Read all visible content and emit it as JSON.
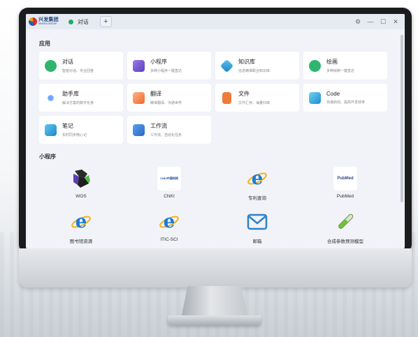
{
  "window": {
    "logo_cn": "兴发集团",
    "logo_en": "XINGFA GROUP",
    "tab_label": "对话",
    "new_tab_symbol": "+",
    "controls": {
      "settings": "⚙",
      "minimize": "—",
      "maximize": "☐",
      "close": "✕"
    }
  },
  "apps": {
    "section_title": "应用",
    "items": [
      {
        "title": "对话",
        "subtitle": "智能对话、专业回答",
        "icon": "chat-ai-icon",
        "color": "#2fb56d"
      },
      {
        "title": "小程序",
        "subtitle": "多种小程序一键直达",
        "icon": "mini-program-icon",
        "color": "#7c5cd6"
      },
      {
        "title": "知识库",
        "subtitle": "信息精准联合知识库",
        "icon": "knowledge-base-icon",
        "color": "#2ca3d8"
      },
      {
        "title": "绘画",
        "subtitle": "多种绘制一键直达",
        "icon": "paint-ai-icon",
        "color": "#2fb56d"
      },
      {
        "title": "助手库",
        "subtitle": "解决方案的数字化身",
        "icon": "assistant-sparkle-icon",
        "color": "#3a7be0"
      },
      {
        "title": "翻译",
        "subtitle": "精准翻译、沟通世界",
        "icon": "translate-icon",
        "color": "#f07a3a"
      },
      {
        "title": "文件",
        "subtitle": "文件汇存、海量归档",
        "icon": "file-icon",
        "color": "#f07a3a"
      },
      {
        "title": "Code",
        "subtitle": "快速启动、提高开发效率",
        "icon": "code-icon",
        "color": "#2ca3d8"
      },
      {
        "title": "笔记",
        "subtitle": "实时同步随心记",
        "icon": "note-icon",
        "color": "#2ca3d8"
      },
      {
        "title": "工作流",
        "subtitle": "工作流、自动化任务",
        "icon": "workflow-icon",
        "color": "#3a7be0"
      }
    ]
  },
  "miniprograms": {
    "section_title": "小程序",
    "items": [
      {
        "label": "WOS",
        "icon": "wos-logo-icon"
      },
      {
        "label": "CNKI",
        "icon": "cnki-logo-icon"
      },
      {
        "label": "专利查询",
        "icon": "ie-browser-icon"
      },
      {
        "label": "PubMed",
        "icon": "pubmed-logo-icon"
      },
      {
        "label": "图书馆资源",
        "icon": "ie-browser-icon"
      },
      {
        "label": "ITIC-SCI",
        "icon": "ie-browser-icon"
      },
      {
        "label": "邮箱",
        "icon": "mail-icon"
      },
      {
        "label": "合成参数预测模型",
        "icon": "test-tube-icon"
      }
    ],
    "cnki_logo_text": "CNKI中国知网",
    "pubmed_logo_text": "PubMed"
  }
}
